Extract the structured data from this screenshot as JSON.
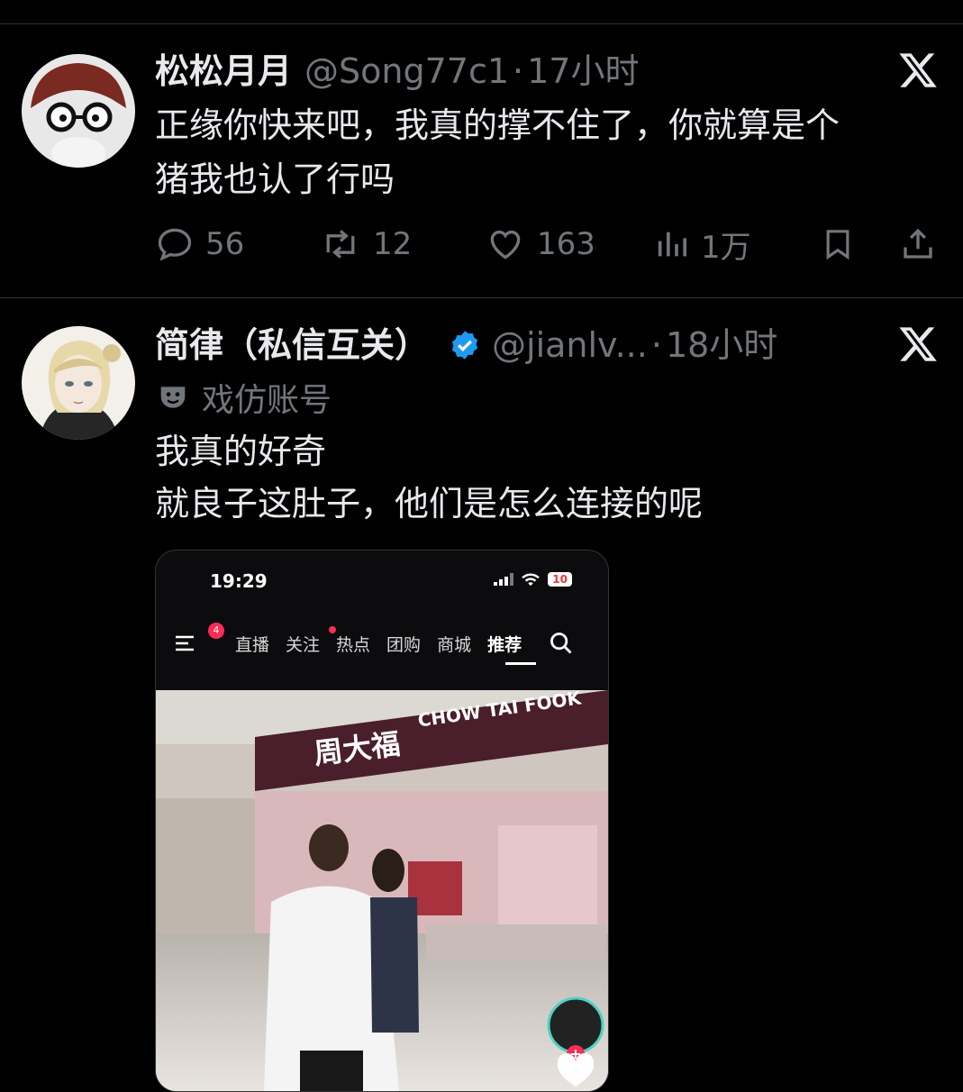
{
  "tweets": [
    {
      "name": "松松月月",
      "handle": "@Song77c1",
      "dot": "·",
      "time": "17小时",
      "lines": [
        "正缘你快来吧，我真的撑不住了，你就算是个",
        "猪我也认了行吗"
      ],
      "stats": {
        "replies": "56",
        "reposts": "12",
        "likes": "163",
        "views": "1万"
      }
    },
    {
      "name": "简律（私信互关）",
      "handle": "@jianlv...",
      "dot": "·",
      "time": "18小时",
      "account_label": "戏仿账号",
      "lines": [
        "我真的好奇",
        "就良子这肚子，他们是怎么连接的呢"
      ]
    }
  ],
  "embedded_screenshot": {
    "time": "19:29",
    "battery": "10",
    "badge": "4",
    "nav": [
      "直播",
      "关注",
      "热点",
      "团购",
      "商城",
      "推荐"
    ],
    "active_tab": "推荐",
    "store_sign_cn": "周大福",
    "store_sign_en": "CHOW TAI FOOK"
  },
  "colors": {
    "background": "#000000",
    "text": "#e7e9ea",
    "muted": "#71767b",
    "verified": "#1d9bf0",
    "accent_red": "#fe2c55"
  },
  "icons": [
    "x-logo-icon",
    "reply-icon",
    "repost-icon",
    "like-icon",
    "views-icon",
    "bookmark-icon",
    "share-icon",
    "verified-badge-icon",
    "parody-mask-icon",
    "menu-icon",
    "search-icon",
    "signal-icon",
    "wifi-icon"
  ]
}
